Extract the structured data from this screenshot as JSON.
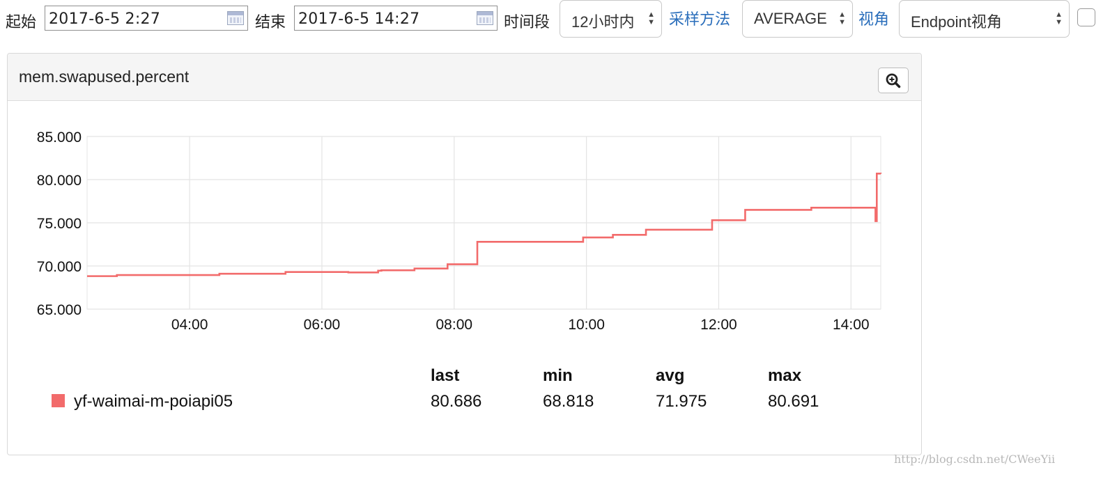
{
  "toolbar": {
    "start_label": "起始",
    "start_value": "2017-6-5 2:27",
    "end_label": "结束",
    "end_value": "2017-6-5 14:27",
    "period_label": "时间段",
    "period_value": "12小时内",
    "sampling_link": "采样方法",
    "sampling_value": "AVERAGE",
    "view_link": "视角",
    "view_value": "Endpoint视角"
  },
  "panel": {
    "title": "mem.swapused.percent"
  },
  "legend": {
    "headers": [
      "last",
      "min",
      "avg",
      "max"
    ],
    "series_name": "yf-waimai-m-poiapi05",
    "values": [
      "80.686",
      "68.818",
      "71.975",
      "80.691"
    ]
  },
  "colors": {
    "series": "#f26b6b",
    "link": "#2a6ebb"
  },
  "watermark": "http://blog.csdn.net/CWeeYii",
  "chart_data": {
    "type": "line",
    "title": "mem.swapused.percent",
    "xlabel": "",
    "ylabel": "",
    "x_unit": "hour",
    "xlim": [
      2.45,
      14.45
    ],
    "ylim": [
      65,
      85
    ],
    "x_ticks": [
      4,
      6,
      8,
      10,
      12,
      14
    ],
    "x_tick_labels": [
      "04:00",
      "06:00",
      "08:00",
      "10:00",
      "12:00",
      "14:00"
    ],
    "y_ticks": [
      65,
      70,
      75,
      80,
      85
    ],
    "y_tick_labels": [
      "65.000",
      "70.000",
      "75.000",
      "80.000",
      "85.000"
    ],
    "grid": true,
    "legend_position": "bottom",
    "series": [
      {
        "name": "yf-waimai-m-poiapi05",
        "color": "#f26b6b",
        "step": true,
        "points": [
          [
            2.45,
            68.82
          ],
          [
            2.9,
            68.95
          ],
          [
            4.45,
            69.1
          ],
          [
            5.45,
            69.3
          ],
          [
            6.4,
            69.25
          ],
          [
            6.85,
            69.45
          ],
          [
            6.9,
            69.5
          ],
          [
            7.4,
            69.7
          ],
          [
            7.9,
            70.2
          ],
          [
            8.35,
            72.8
          ],
          [
            9.95,
            73.3
          ],
          [
            10.4,
            73.6
          ],
          [
            10.9,
            74.2
          ],
          [
            11.9,
            75.3
          ],
          [
            12.4,
            76.5
          ],
          [
            13.4,
            76.75
          ],
          [
            14.35,
            76.75
          ],
          [
            14.37,
            75.2
          ],
          [
            14.39,
            80.7
          ],
          [
            14.45,
            80.69
          ]
        ]
      }
    ]
  }
}
